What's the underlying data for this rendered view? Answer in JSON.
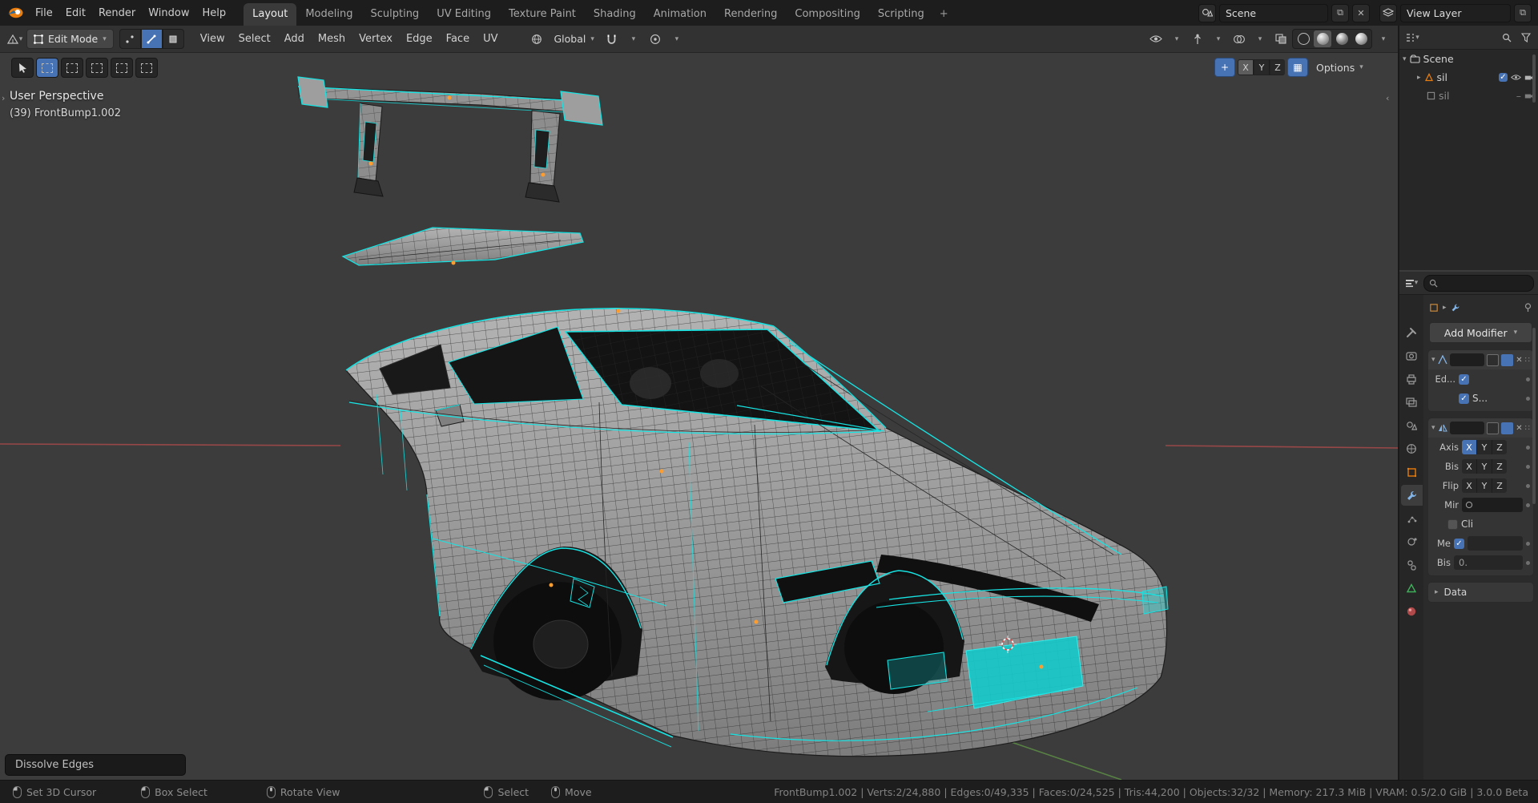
{
  "topbar": {
    "menus": [
      "File",
      "Edit",
      "Render",
      "Window",
      "Help"
    ],
    "tabs": [
      "Layout",
      "Modeling",
      "Sculpting",
      "UV Editing",
      "Texture Paint",
      "Shading",
      "Animation",
      "Rendering",
      "Compositing",
      "Scripting"
    ],
    "active_tab": "Layout",
    "add_tab": "+",
    "scene_label": "Scene",
    "view_layer_label": "View Layer"
  },
  "header": {
    "mode": "Edit Mode",
    "menus": [
      "View",
      "Select",
      "Add",
      "Mesh",
      "Vertex",
      "Edge",
      "Face",
      "UV"
    ],
    "orientation": "Global",
    "axis": [
      "X",
      "Y",
      "Z"
    ],
    "options_label": "Options"
  },
  "viewport": {
    "perspective": "User Perspective",
    "object": "(39) FrontBump1.002",
    "operator": "Dissolve Edges"
  },
  "outliner": {
    "root": "Scene",
    "item1": "sil",
    "item2": "sil"
  },
  "props": {
    "add_modifier": "Add Modifier",
    "row_ed": "Ed...",
    "row_s": "S...",
    "axis": "Axis",
    "bis": "Bis",
    "flip": "Flip",
    "mir": "Mir",
    "cli": "Cli",
    "me": "Me",
    "bis2": "Bis",
    "bis2_value": "0.",
    "data": "Data",
    "xyz": [
      "X",
      "Y",
      "Z"
    ]
  },
  "status": {
    "hints": [
      "Set 3D Cursor",
      "Box Select",
      "Rotate View",
      "Select",
      "Move"
    ],
    "stats": "FrontBump1.002 | Verts:2/24,880 | Edges:0/49,335 | Faces:0/24,525 | Tris:44,200 | Objects:32/32 | Memory: 217.3 MiB | VRAM: 0.5/2.0 GiB | 3.0.0 Beta"
  },
  "colors": {
    "accent_blue": "#4772b3",
    "selected_edge_cyan": "#17e3e3",
    "object_orange": "#e87d0d",
    "viewport_bg": "#3c3c3c"
  }
}
